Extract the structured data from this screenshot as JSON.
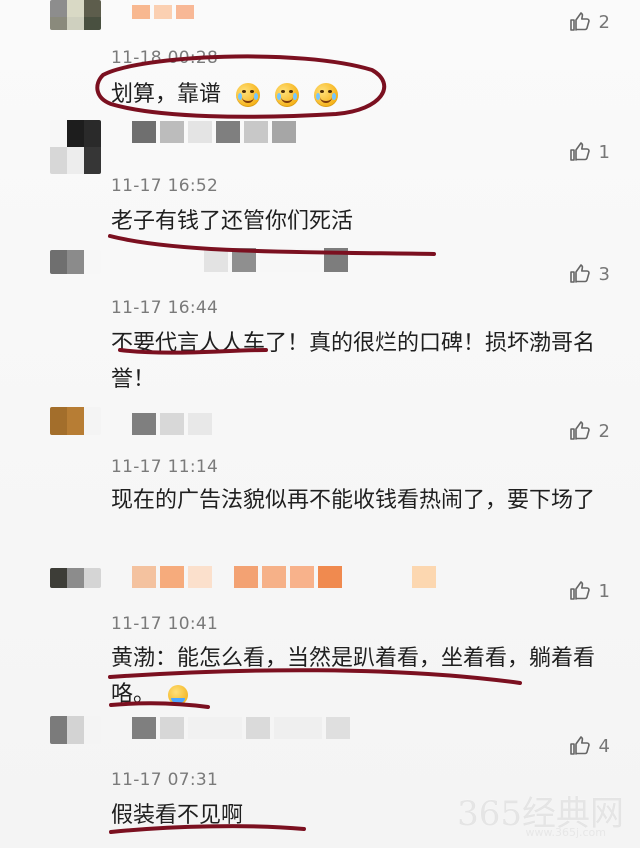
{
  "comments": [
    {
      "time": "11-18 00:28",
      "text": "划算，靠谱",
      "likes": "2",
      "emoji_count": 3
    },
    {
      "time": "11-17 16:52",
      "text": "老子有钱了还管你们死活",
      "likes": "1"
    },
    {
      "time": "11-17 16:44",
      "text": "不要代言人人车了！真的很烂的口碑！损坏渤哥名誉！",
      "likes": "3"
    },
    {
      "time": "11-17 11:14",
      "text": "现在的广告法貌似再不能收钱看热闹了，要下场了",
      "likes": "2"
    },
    {
      "time": "11-17 10:41",
      "text": "黄渤：能怎么看，当然是趴着看，坐着看，躺着看咯。",
      "likes": "1"
    },
    {
      "time": "11-17 07:31",
      "text": "假装看不见啊",
      "likes": "4"
    }
  ],
  "watermark": {
    "main": "365经典网",
    "sub": "www.365j.com"
  },
  "colors": {
    "background": "#f7f7f7",
    "text": "#1f1f1f",
    "meta": "#7a7a7a",
    "annotation": "#7b1020"
  }
}
